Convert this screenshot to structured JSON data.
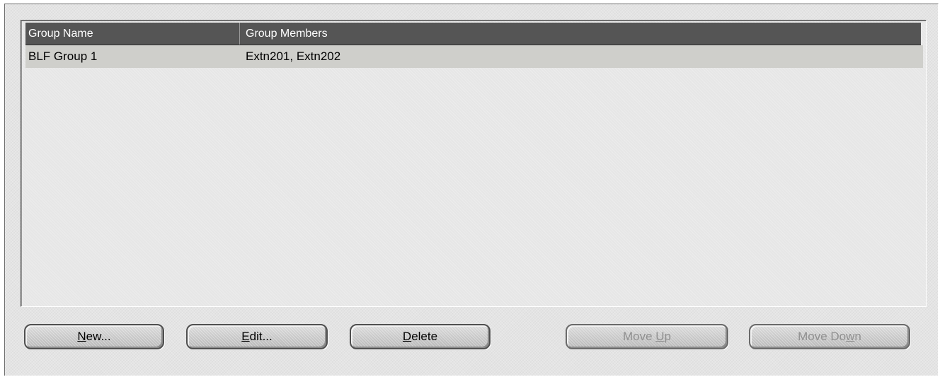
{
  "list": {
    "columns": [
      "Group Name",
      "Group Members"
    ],
    "rows": [
      {
        "name": "BLF Group 1",
        "members": "Extn201, Extn202",
        "selected": true
      }
    ]
  },
  "buttons": {
    "new": {
      "pre": "",
      "key": "N",
      "post": "ew...",
      "enabled": true
    },
    "edit": {
      "pre": "",
      "key": "E",
      "post": "dit...",
      "enabled": true
    },
    "delete": {
      "pre": "",
      "key": "D",
      "post": "elete",
      "enabled": true
    },
    "move_up": {
      "pre": "Move ",
      "key": "U",
      "post": "p",
      "enabled": false
    },
    "move_down": {
      "pre": "Move Do",
      "key": "w",
      "post": "n",
      "enabled": false
    }
  },
  "colors": {
    "header_bg": "#555555",
    "selected_row_bg": "#cfcfcb",
    "panel_bg": "#e4e4e4",
    "disabled_text": "#909090"
  }
}
